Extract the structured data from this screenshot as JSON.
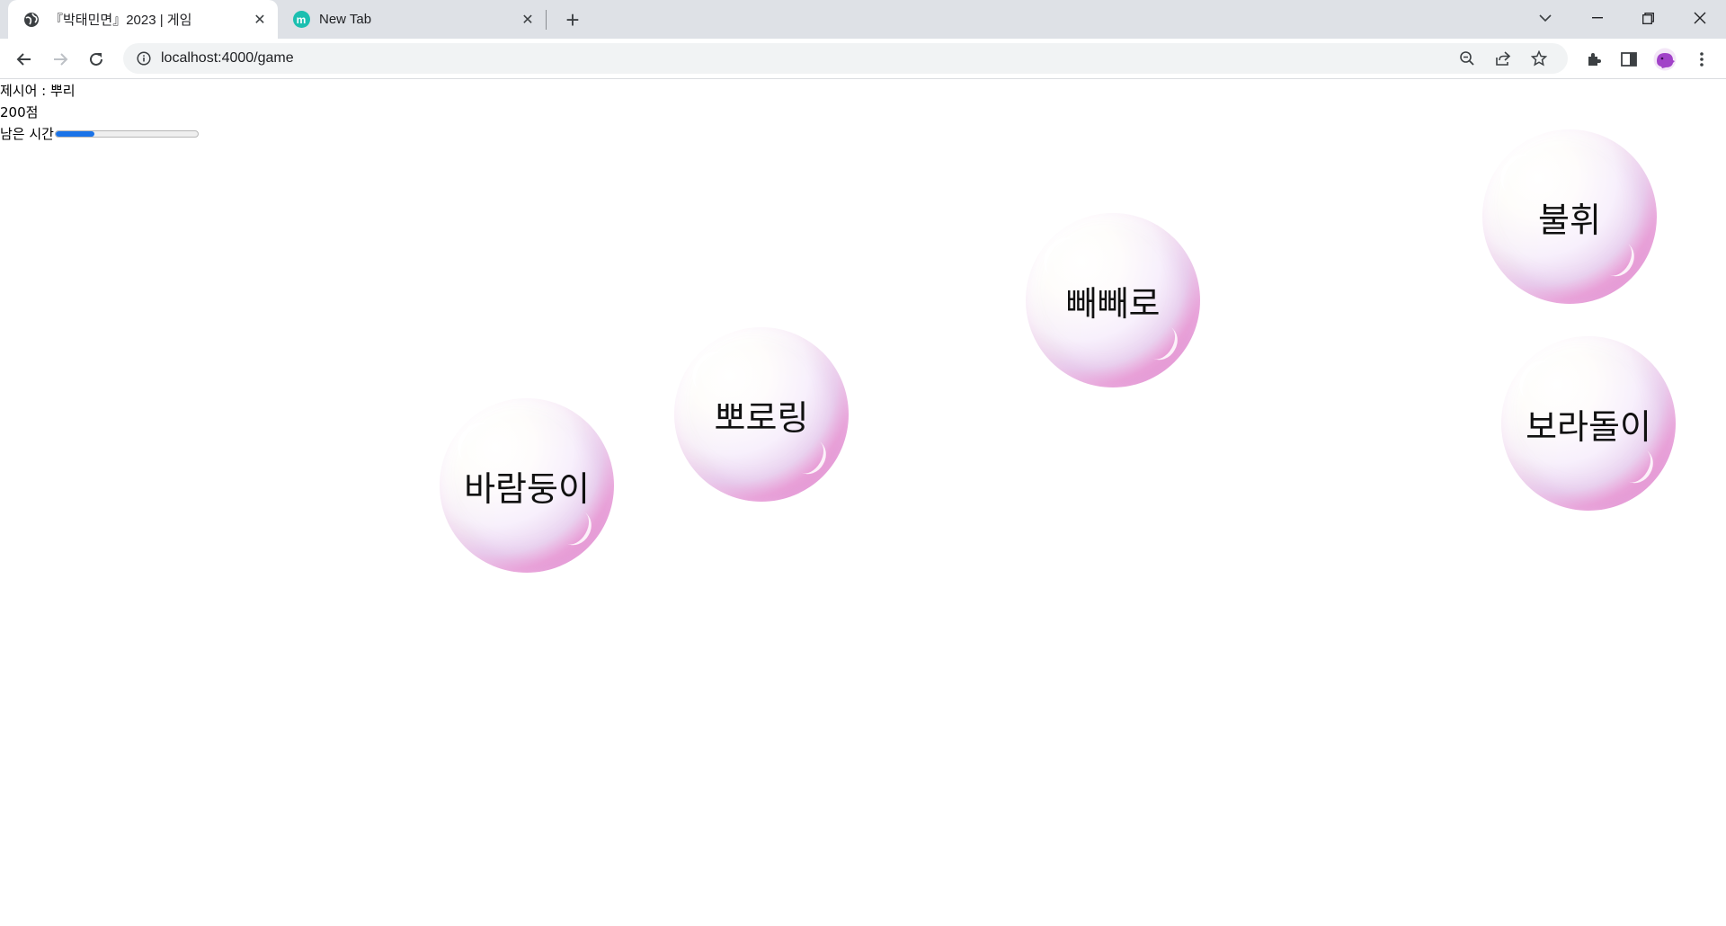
{
  "browser": {
    "tabs": [
      {
        "title": "『박태민면』2023 | 게임",
        "favicon": "globe-icon",
        "active": true
      },
      {
        "title": "New Tab",
        "favicon": "m-badge-icon",
        "favicon_letter": "m",
        "active": false
      }
    ],
    "address_bar": {
      "url": "localhost:4000/game"
    },
    "profile_color": "#a142c8",
    "accent_color": "#1a73e8"
  },
  "game": {
    "hint_label": "제시어 : 뿌리",
    "score_label": "200점",
    "timer_label": "남은 시간",
    "timer_remaining_fraction": 0.27,
    "bubbles": [
      {
        "word": "불휘"
      },
      {
        "word": "빼빼로"
      },
      {
        "word": "뽀로링"
      },
      {
        "word": "보라돌이"
      },
      {
        "word": "바람둥이"
      }
    ]
  }
}
